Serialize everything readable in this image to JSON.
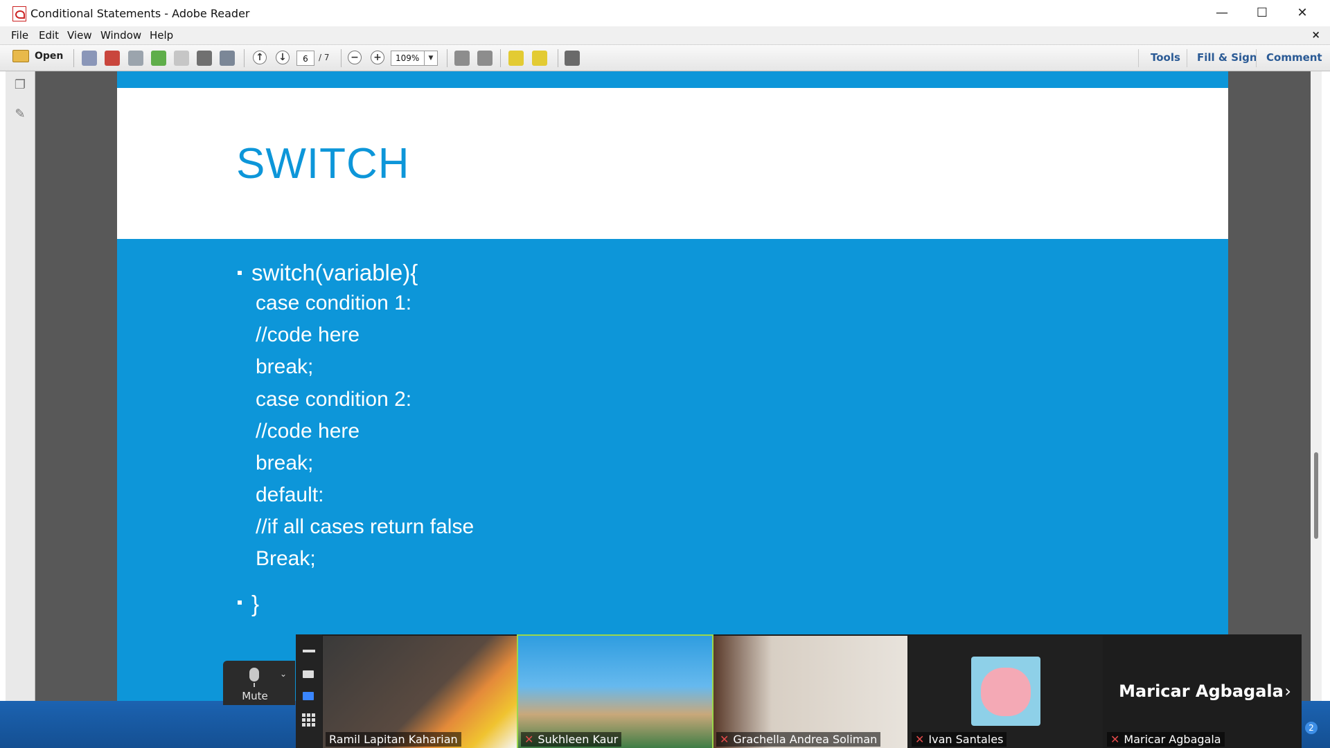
{
  "window": {
    "title": "Conditional Statements - Adobe Reader",
    "controls": {
      "minimize": "—",
      "maximize": "☐",
      "close": "✕"
    }
  },
  "menu": {
    "items": [
      "File",
      "Edit",
      "View",
      "Window",
      "Help"
    ],
    "close": "×"
  },
  "toolbar": {
    "open_label": "Open",
    "page_current": "6",
    "page_total": "/ 7",
    "zoom": "109%",
    "zoom_in": "+",
    "zoom_out": "−",
    "right_links": [
      "Tools",
      "Fill & Sign",
      "Comment"
    ]
  },
  "slide": {
    "title": "SWITCH",
    "first_bullet": "switch(variable){",
    "code_lines": [
      "case condition 1:",
      "//code here",
      "break;",
      "case condition 2:",
      "//code here",
      "break;",
      "default:",
      "//if all cases return false",
      "Break;"
    ],
    "second_bullet": "}"
  },
  "meeting": {
    "mute_label": "Mute",
    "participants": [
      {
        "name": "Ramil Lapitan Kaharian",
        "muted": false
      },
      {
        "name": "Sukhleen Kaur",
        "muted": true
      },
      {
        "name": "Grachella Andrea Soliman",
        "muted": true
      },
      {
        "name": "Ivan Santales",
        "muted": true
      },
      {
        "name": "Maricar Agbagala",
        "muted": true
      }
    ],
    "featured_name": "Maricar Agbagala",
    "next": "›"
  },
  "tray": {
    "badge": "2"
  }
}
